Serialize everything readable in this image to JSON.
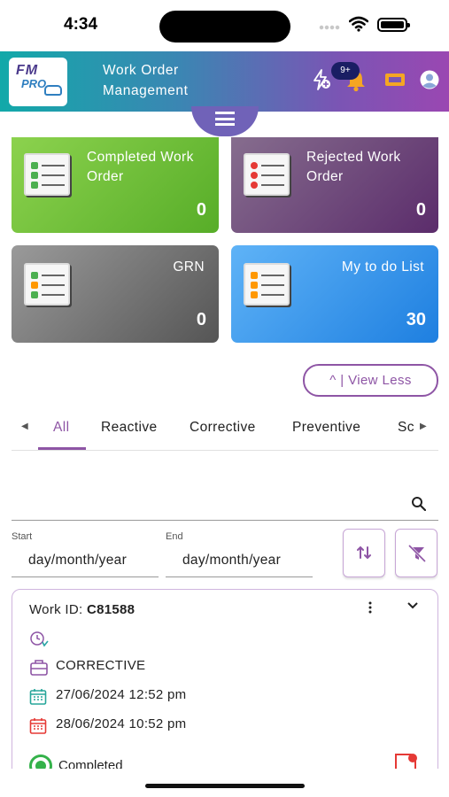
{
  "status_bar": {
    "time": "4:34",
    "icons": [
      "signal-icon",
      "wifi-icon",
      "battery-icon"
    ]
  },
  "header": {
    "logo_text": "FM",
    "logo_sub": "PRO",
    "title": "Work Order Management",
    "notification_badge": "9+",
    "icons": [
      "bolt-icon",
      "bell-icon",
      "ticket-icon",
      "user-icon",
      "menu-icon"
    ],
    "gradient_colors": [
      "#12a9a9",
      "#9a47b2"
    ]
  },
  "cards": {
    "completed": {
      "title": "Completed Work Order",
      "count": "0",
      "color": "#6cbd38"
    },
    "rejected": {
      "title": "Rejected Work Order",
      "count": "0",
      "color": "#6e4a7a"
    },
    "grn": {
      "title": "GRN",
      "count": "0",
      "color": "#7a7a7a"
    },
    "todo": {
      "title": "My to do List",
      "count": "30",
      "color": "#3a98ec"
    }
  },
  "view_less": {
    "label": "^ | View Less"
  },
  "tabs": {
    "items": [
      "All",
      "Reactive",
      "Corrective",
      "Preventive",
      "Sc"
    ],
    "active": "All",
    "accent": "#8e55a5"
  },
  "search": {
    "placeholder": ""
  },
  "dates": {
    "start_label": "Start",
    "start_value": "day/month/year",
    "end_label": "End",
    "end_value": "day/month/year"
  },
  "work_order": {
    "id_label": "Work ID: ",
    "id_value": "C81588",
    "type": "CORRECTIVE",
    "start_datetime": "27/06/2024 12:52 pm",
    "end_datetime": "28/06/2024 10:52 pm",
    "status": "Completed",
    "status_color": "#34b24a"
  }
}
